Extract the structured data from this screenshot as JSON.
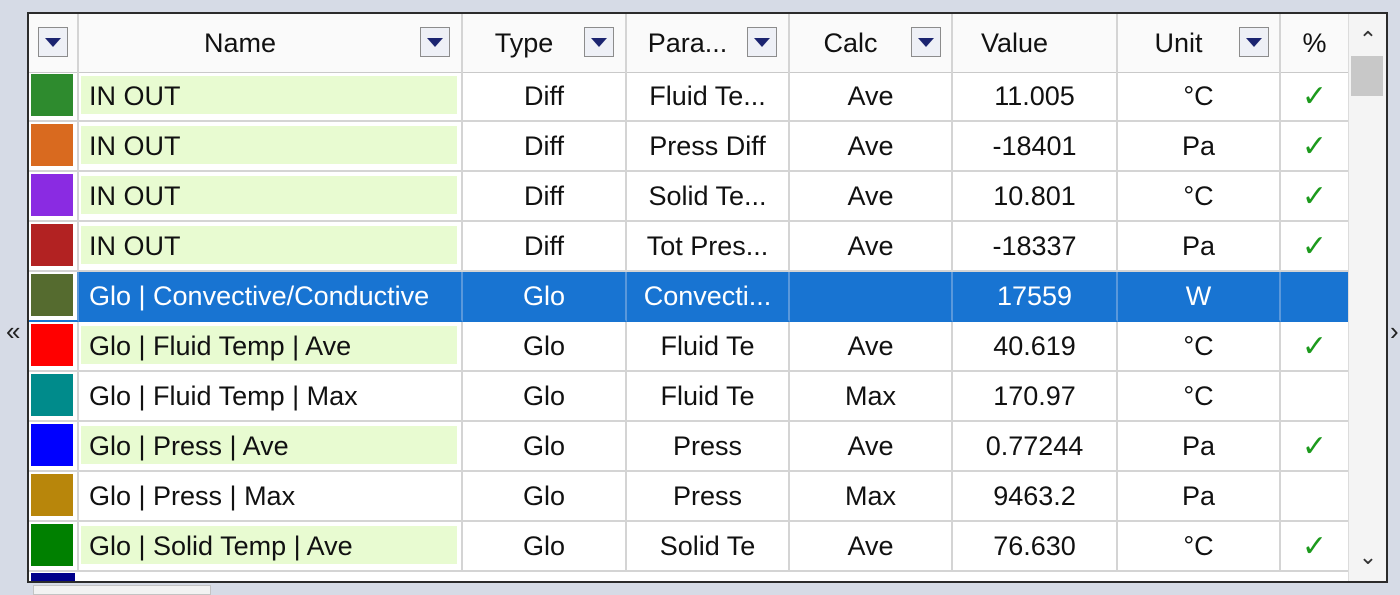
{
  "columns": {
    "name": "Name",
    "type": "Type",
    "param": "Para...",
    "calc": "Calc",
    "value": "Value",
    "unit": "Unit",
    "percent": "%"
  },
  "rows": [
    {
      "color": "#2e8b2e",
      "name": "IN OUT",
      "type": "Diff",
      "param": "Fluid Te...",
      "calc": "Ave",
      "value": "11.005",
      "unit": "°C",
      "checked": true
    },
    {
      "color": "#d96a1f",
      "name": "IN OUT",
      "type": "Diff",
      "param": "Press Diff",
      "calc": "Ave",
      "value": "-18401",
      "unit": "Pa",
      "checked": true
    },
    {
      "color": "#8a2be2",
      "name": "IN OUT",
      "type": "Diff",
      "param": "Solid Te...",
      "calc": "Ave",
      "value": "10.801",
      "unit": "°C",
      "checked": true
    },
    {
      "color": "#b22222",
      "name": "IN OUT",
      "type": "Diff",
      "param": "Tot Pres...",
      "calc": "Ave",
      "value": "-18337",
      "unit": "Pa",
      "checked": true
    },
    {
      "color": "#556b2f",
      "name": "Glo | Convective/Conductive",
      "type": "Glo",
      "param": "Convecti...",
      "calc": "",
      "value": "17559",
      "unit": "W",
      "checked": false,
      "selected": true
    },
    {
      "color": "#ff0000",
      "name": "Glo | Fluid Temp | Ave",
      "type": "Glo",
      "param": "Fluid Te",
      "calc": "Ave",
      "value": "40.619",
      "unit": "°C",
      "checked": true
    },
    {
      "color": "#008b8b",
      "name": "Glo | Fluid Temp | Max",
      "type": "Glo",
      "param": "Fluid Te",
      "calc": "Max",
      "value": "170.97",
      "unit": "°C",
      "checked": false
    },
    {
      "color": "#0000ff",
      "name": "Glo | Press | Ave",
      "type": "Glo",
      "param": "Press",
      "calc": "Ave",
      "value": "0.77244",
      "unit": "Pa",
      "checked": true
    },
    {
      "color": "#b8860b",
      "name": "Glo | Press | Max",
      "type": "Glo",
      "param": "Press",
      "calc": "Max",
      "value": "9463.2",
      "unit": "Pa",
      "checked": false
    },
    {
      "color": "#008000",
      "name": "Glo | Solid Temp | Ave",
      "type": "Glo",
      "param": "Solid Te",
      "calc": "Ave",
      "value": "76.630",
      "unit": "°C",
      "checked": true
    }
  ],
  "check_symbol": "✓",
  "icons": {
    "scroll_up": "chevron-up-icon",
    "scroll_down": "chevron-down-icon",
    "left_arrow": "double-chevron-left-icon",
    "right_arrow": "chevron-right-icon"
  },
  "glyphs": {
    "up": "⌃",
    "down": "⌄",
    "left": "«",
    "right": "›"
  }
}
